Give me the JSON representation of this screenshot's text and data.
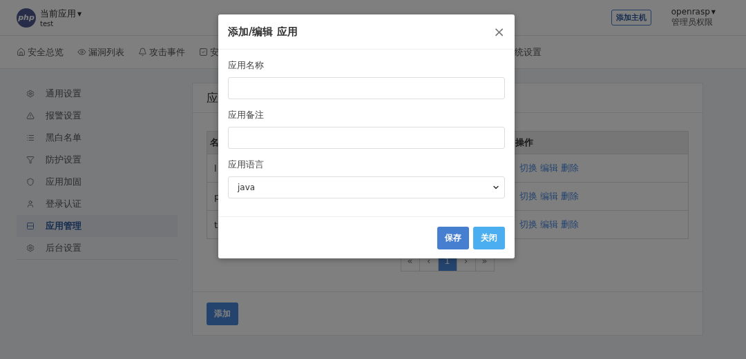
{
  "header": {
    "logo": "php",
    "app_switch": {
      "label": "当前应用",
      "caret": "▼",
      "value": "test"
    },
    "add_host_button": "添加主机",
    "user": {
      "name": "openrasp",
      "caret": "▼",
      "role": "管理员权限"
    }
  },
  "nav": {
    "items": [
      {
        "label": "安全总览"
      },
      {
        "label": "漏洞列表"
      },
      {
        "label": "攻击事件"
      },
      {
        "label": "安"
      }
    ],
    "trailing_items": [
      {
        "label": "统设置"
      }
    ]
  },
  "sidebar": {
    "items": [
      {
        "label": "通用设置",
        "selected": false
      },
      {
        "label": "报警设置",
        "selected": false
      },
      {
        "label": "黑白名单",
        "selected": false
      },
      {
        "label": "防护设置",
        "selected": false
      },
      {
        "label": "应用加固",
        "selected": false
      },
      {
        "label": "登录认证",
        "selected": false
      },
      {
        "label": "应用管理",
        "selected": true
      },
      {
        "label": "后台设置",
        "selected": false
      }
    ]
  },
  "card": {
    "title": "应",
    "table": {
      "columns": [
        "名",
        "操作"
      ],
      "rows": [
        {
          "cells": [
            "l"
          ],
          "actions": [
            "切换",
            "编辑",
            "删除"
          ]
        },
        {
          "cells": [
            "p"
          ],
          "actions": [
            "切换",
            "编辑",
            "删除"
          ]
        },
        {
          "cells": [
            "t"
          ],
          "actions": [
            "切换",
            "编辑",
            "删除"
          ]
        }
      ]
    },
    "pagination": [
      {
        "label": "«",
        "selected": false
      },
      {
        "label": "‹",
        "selected": false
      },
      {
        "label": "1",
        "selected": true
      },
      {
        "label": "›",
        "selected": false
      },
      {
        "label": "»",
        "selected": false
      }
    ],
    "add_button": "添加"
  },
  "modal": {
    "title": "添加/编辑 应用",
    "close": "×",
    "fields": [
      {
        "label": "应用名称",
        "kind": "text"
      },
      {
        "label": "应用备注",
        "kind": "text"
      },
      {
        "label": "应用语言",
        "kind": "select",
        "value": "java"
      }
    ],
    "buttons": [
      {
        "label": "保存",
        "kind": "primary"
      },
      {
        "label": "关闭",
        "kind": "info"
      }
    ]
  }
}
